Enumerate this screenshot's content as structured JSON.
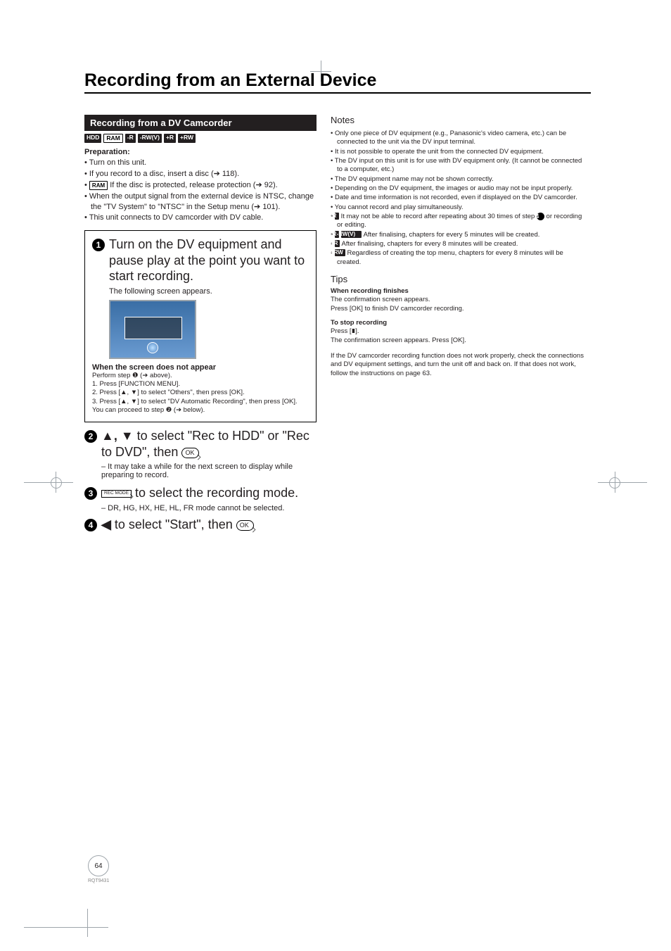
{
  "title": "Recording from an External Device",
  "section_header": "Recording from a DV Camcorder",
  "badges": [
    {
      "text": "HDD",
      "variant": "dark"
    },
    {
      "text": "RAM",
      "variant": "light"
    },
    {
      "text": "-R",
      "variant": "dark"
    },
    {
      "text": "-RW(V)",
      "variant": "dark"
    },
    {
      "text": "+R",
      "variant": "dark"
    },
    {
      "text": "+RW",
      "variant": "dark"
    }
  ],
  "preparation": {
    "heading": "Preparation:",
    "items": [
      "Turn on this unit.",
      "If you record to a disc, insert a disc (➔ 118).",
      "[RAM] If the disc is protected, release protection (➔ 92).",
      "When the output signal from the external device is NTSC, change the \"TV System\" to \"NTSC\" in the Setup menu (➔ 101).",
      "This unit connects to DV camcorder with DV cable."
    ]
  },
  "step1": {
    "num": "1",
    "text": "Turn on the DV equipment and pause play at the point you want to start recording.",
    "sub": "The following screen appears.",
    "no_appear_heading": "When the screen does not appear",
    "no_appear_lines": [
      "Perform step ❶ (➔ above).",
      "1. Press [FUNCTION MENU].",
      "2. Press [▲, ▼] to select \"Others\", then press [OK].",
      "3. Press [▲, ▼] to select \"DV Automatic Recording\", then press [OK].",
      "You can proceed to step ❷ (➔ below)."
    ]
  },
  "step2": {
    "num": "2",
    "text_a": "▲, ▼ to select \"Rec to HDD\" or \"Rec to DVD\", then ",
    "ok": "OK",
    "sub": "– It may take a while for the next screen to display while preparing to record."
  },
  "step3": {
    "num": "3",
    "recmode_label": "REC MODE",
    "text": " to select the recording mode.",
    "sub": "– DR, HG, HX, HE, HL, FR mode cannot be selected."
  },
  "step4": {
    "num": "4",
    "text_a": "◀ to select \"Start\", then ",
    "ok": "OK"
  },
  "notes": {
    "title": "Notes",
    "items": [
      "Only one piece of DV equipment (e.g., Panasonic's video camera, etc.) can be connected to the unit via the DV input terminal.",
      "It is not possible to operate the unit from the connected DV equipment.",
      "The DV input on this unit is for use with DV equipment only. (It cannot be connected to a computer, etc.)",
      "The DV equipment name may not be shown correctly.",
      "Depending on the DV equipment, the images or audio may not be input properly.",
      "Date and time information is not recorded, even if displayed on the DV camcorder.",
      "You cannot record and play simultaneously."
    ],
    "badge_items": [
      {
        "badge": "-R",
        "text": "It may not be able to record after repeating about 30 times of step ❹ or recording or editing."
      },
      {
        "badge": "-R  -RW(V)",
        "text": "After finalising, chapters for every 5 minutes will be created."
      },
      {
        "badge": "+R",
        "text": "After finalising, chapters for every 8 minutes will be created."
      },
      {
        "badge": "+RW",
        "text": "Regardless of creating the top menu, chapters for every 8 minutes will be created."
      }
    ]
  },
  "tips": {
    "title": "Tips",
    "finish_heading": "When recording finishes",
    "finish_lines": [
      "The confirmation screen appears.",
      "Press [OK] to finish DV camcorder recording."
    ],
    "stop_heading": "To stop recording",
    "stop_lines": [
      "Press [∎].",
      "The confirmation screen appears. Press [OK]."
    ],
    "footer": "If the DV camcorder recording function does not work properly, check the connections and DV equipment settings, and turn the unit off and back on. If that does not work, follow the instructions on page 63."
  },
  "page_number": "64",
  "doc_code": "RQT9431"
}
